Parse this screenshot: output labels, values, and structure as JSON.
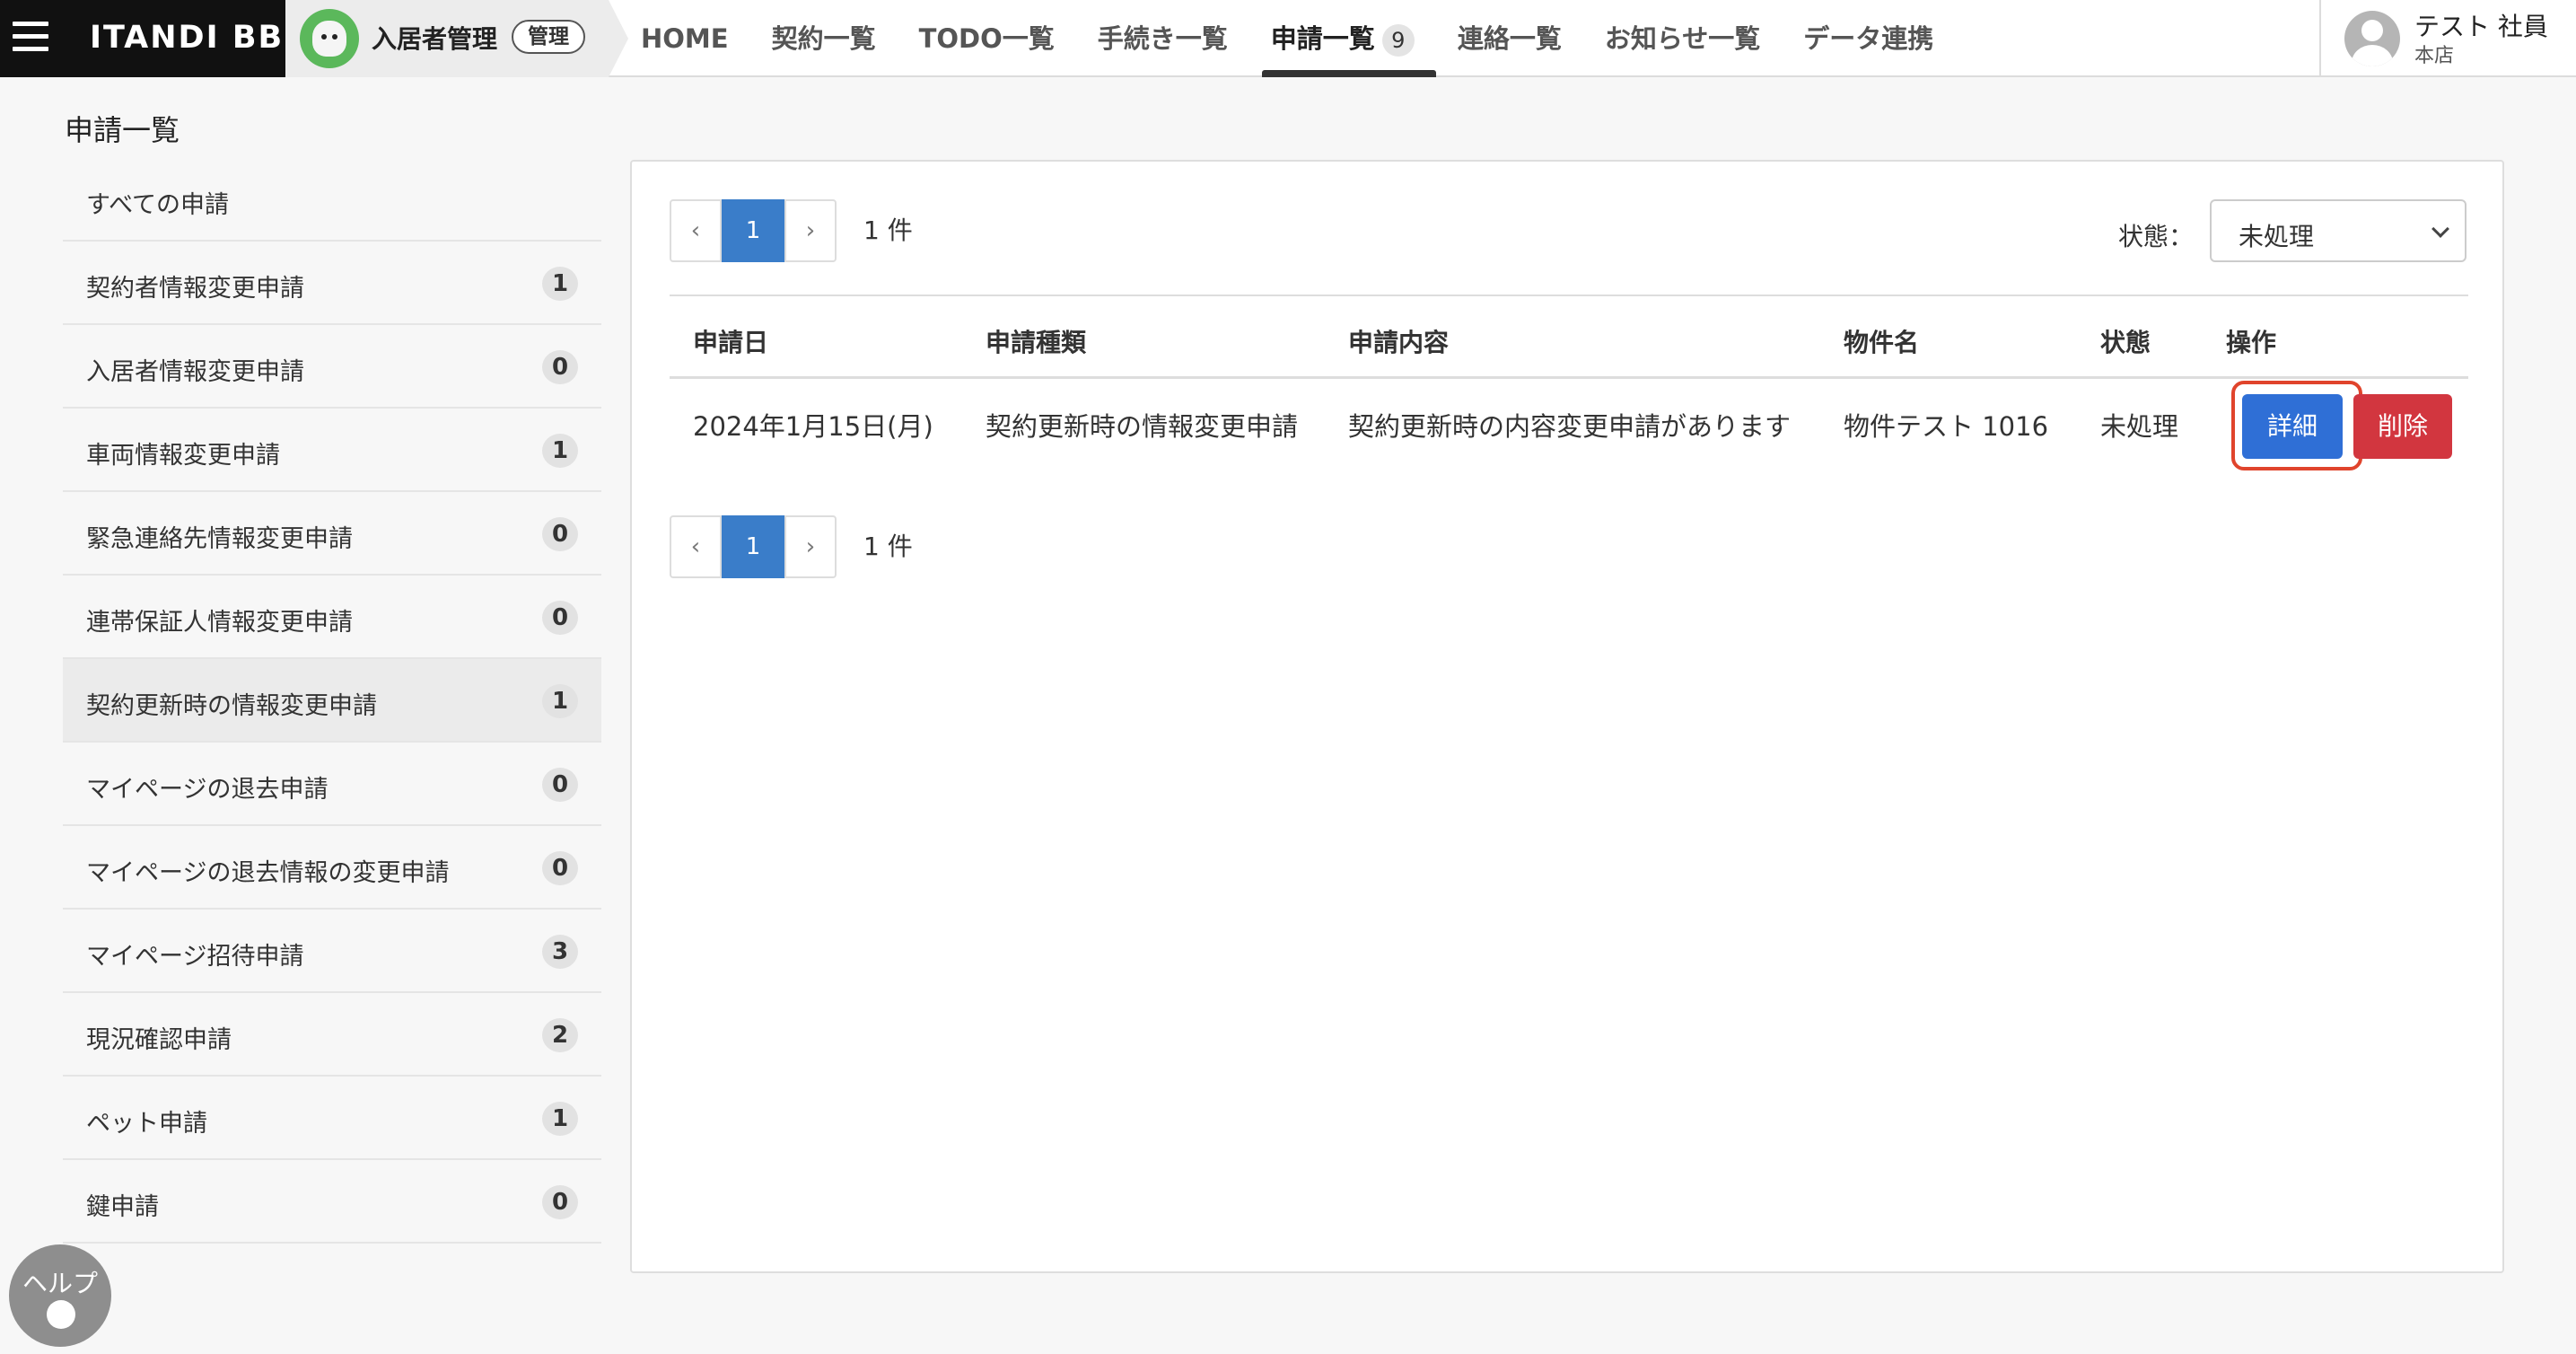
{
  "header": {
    "brand": "ITANDI BB",
    "module_name": "入居者管理",
    "admin_badge": "管理",
    "nav": [
      {
        "label": "HOME"
      },
      {
        "label": "契約一覧"
      },
      {
        "label": "TODO一覧"
      },
      {
        "label": "手続き一覧"
      },
      {
        "label": "申請一覧",
        "count": "9",
        "active": true
      },
      {
        "label": "連絡一覧"
      },
      {
        "label": "お知らせ一覧"
      },
      {
        "label": "データ連携"
      }
    ],
    "user": {
      "name": "テスト 社員",
      "branch": "本店"
    }
  },
  "page": {
    "title": "申請一覧"
  },
  "sidebar": {
    "items": [
      {
        "label": "すべての申請",
        "count": ""
      },
      {
        "label": "契約者情報変更申請",
        "count": "1"
      },
      {
        "label": "入居者情報変更申請",
        "count": "0"
      },
      {
        "label": "車両情報変更申請",
        "count": "1"
      },
      {
        "label": "緊急連絡先情報変更申請",
        "count": "0"
      },
      {
        "label": "連帯保証人情報変更申請",
        "count": "0"
      },
      {
        "label": "契約更新時の情報変更申請",
        "count": "1",
        "active": true
      },
      {
        "label": "マイページの退去申請",
        "count": "0"
      },
      {
        "label": "マイページの退去情報の変更申請",
        "count": "0"
      },
      {
        "label": "マイページ招待申請",
        "count": "3"
      },
      {
        "label": "現況確認申請",
        "count": "2"
      },
      {
        "label": "ペット申請",
        "count": "1"
      },
      {
        "label": "鍵申請",
        "count": "0"
      }
    ]
  },
  "pagination": {
    "prev": "‹",
    "current": "1",
    "next": "›",
    "count_text": "1 件"
  },
  "filter": {
    "label": "状態：",
    "value": "未処理"
  },
  "table": {
    "headers": [
      "申請日",
      "申請種類",
      "申請内容",
      "物件名",
      "状態",
      "操作"
    ],
    "rows": [
      {
        "date": "2024年1月15日(月)",
        "type": "契約更新時の情報変更申請",
        "content": "契約更新時の内容変更申請があります",
        "property": "物件テスト 1016",
        "status": "未処理",
        "detail_label": "詳細",
        "delete_label": "削除"
      }
    ]
  },
  "help": {
    "label": "ヘルプ"
  },
  "colors": {
    "primary": "#2f6fd6",
    "danger": "#d2363f",
    "pager_active": "#3a7dc9",
    "highlight": "#e0442c"
  }
}
